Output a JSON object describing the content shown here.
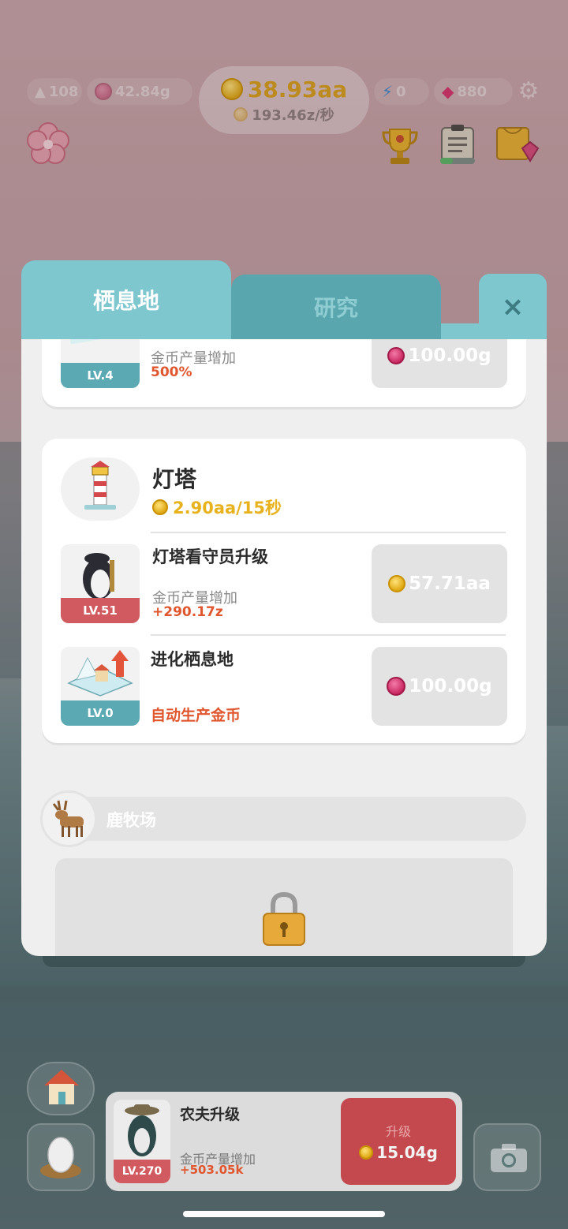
{
  "hud": {
    "arrows_count": "108",
    "gems_weight": "42.84g",
    "coins_total": "38.93aa",
    "coins_rate": "193.46z/秒",
    "energy": "0",
    "diamonds": "880"
  },
  "tabs": [
    {
      "label": "栖息地",
      "active": true
    },
    {
      "label": "研究",
      "active": false
    }
  ],
  "close_label": "×",
  "cards": {
    "top_partial": {
      "level": "LV.4",
      "effect_label": "金币产量增加",
      "effect_value": "500%",
      "price": "100.00g"
    },
    "lighthouse": {
      "name": "灯塔",
      "yield": "2.90aa/15秒",
      "upgrade": {
        "title": "灯塔看守员升级",
        "level": "LV.51",
        "effect_label": "金币产量增加",
        "effect_value": "+290.17z",
        "price": "57.71aa"
      },
      "evolve": {
        "title": "进化栖息地",
        "level": "LV.0",
        "effect": "自动生产金币",
        "price": "100.00g"
      }
    }
  },
  "locked_section": {
    "name": "鹿牧场"
  },
  "bottom_bar": {
    "farmer": {
      "title": "农夫升级",
      "level": "LV.270",
      "effect_label": "金币产量增加",
      "effect_value": "+503.05k",
      "button_label": "升级",
      "price": "15.04g"
    }
  },
  "colors": {
    "accent_teal": "#7ec7cf",
    "accent_red": "#d05a5f",
    "effect_orange": "#e0572f",
    "coin_yellow": "#e8b21c"
  }
}
